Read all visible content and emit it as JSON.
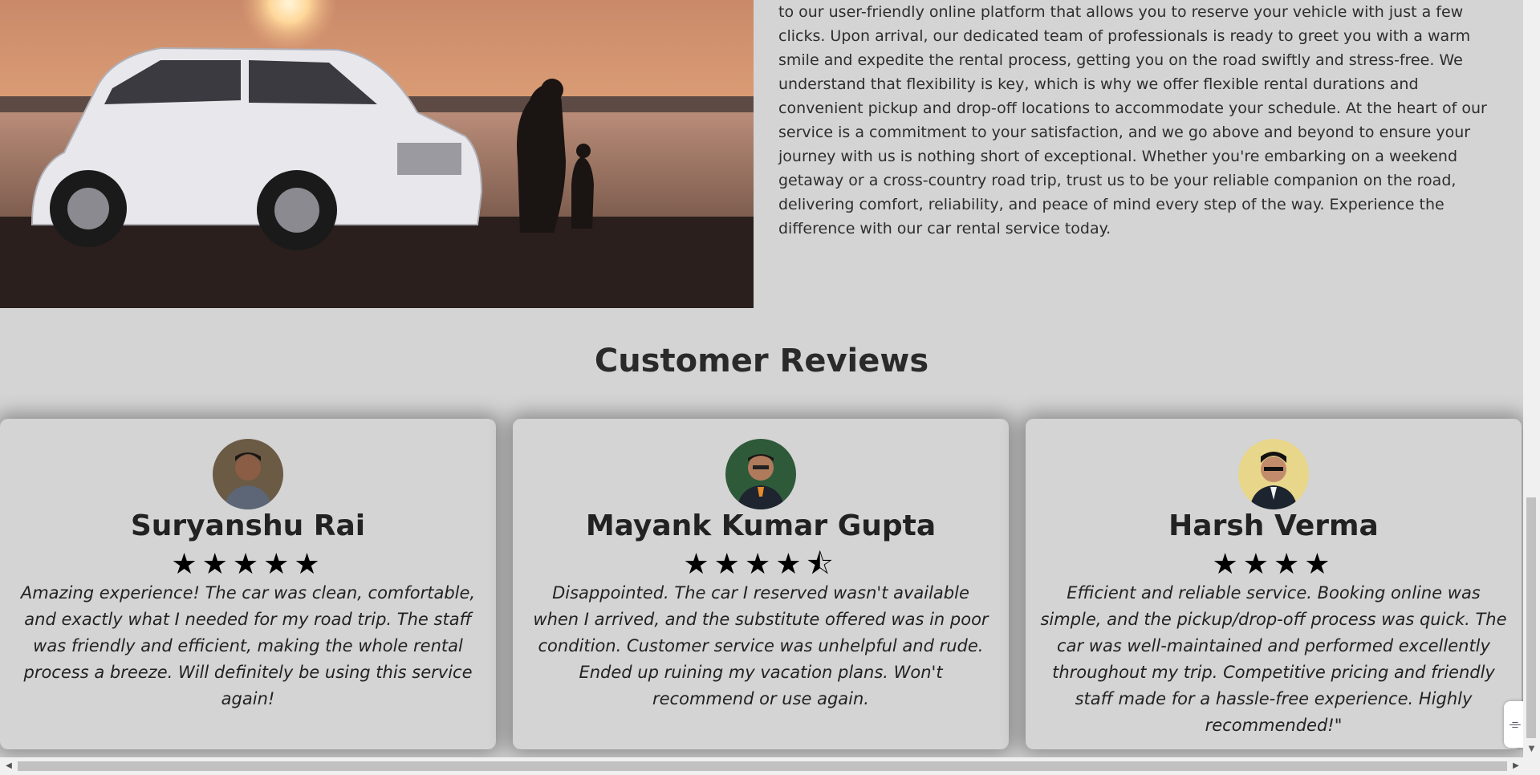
{
  "about": {
    "paragraph": "to our user-friendly online platform that allows you to reserve your vehicle with just a few clicks. Upon arrival, our dedicated team of professionals is ready to greet you with a warm smile and expedite the rental process, getting you on the road swiftly and stress-free. We understand that flexibility is key, which is why we offer flexible rental durations and convenient pickup and drop-off locations to accommodate your schedule. At the heart of our service is a commitment to your satisfaction, and we go above and beyond to ensure your journey with us is nothing short of exceptional. Whether you're embarking on a weekend getaway or a cross-country road trip, trust us to be your reliable companion on the road, delivering comfort, reliability, and peace of mind every step of the way. Experience the difference with our car rental service today.",
    "image_icon": "car-sunset-photo"
  },
  "reviews": {
    "title": "Customer Reviews",
    "items": [
      {
        "name": "Suryanshu Rai",
        "rating": 5,
        "stars": "★★★★★",
        "text": "Amazing experience! The car was clean, comfortable, and exactly what I needed for my road trip. The staff was friendly and efficient, making the whole rental process a breeze. Will definitely be using this service again!",
        "avatar_bg": "#6b5a44"
      },
      {
        "name": "Mayank Kumar Gupta",
        "rating": 4.5,
        "stars": "★★★★⯪",
        "text": "Disappointed. The car I reserved wasn't available when I arrived, and the substitute offered was in poor condition. Customer service was unhelpful and rude. Ended up ruining my vacation plans. Won't recommend or use again.",
        "avatar_bg": "#2f5a3a"
      },
      {
        "name": "Harsh Verma",
        "rating": 4,
        "stars": "★★★★",
        "text": "Efficient and reliable service. Booking online was simple, and the pickup/drop-off process was quick. The car was well-maintained and performed excellently throughout my trip. Competitive pricing and friendly staff made for a hassle-free experience. Highly recommended!\"",
        "avatar_bg": "#e8d68a"
      }
    ]
  },
  "scrollbar": {
    "vertical_down_arrow": "▼",
    "horizontal_left_arrow": "◀",
    "horizontal_right_arrow": "▶"
  },
  "widget": {
    "icon": "⌯"
  }
}
